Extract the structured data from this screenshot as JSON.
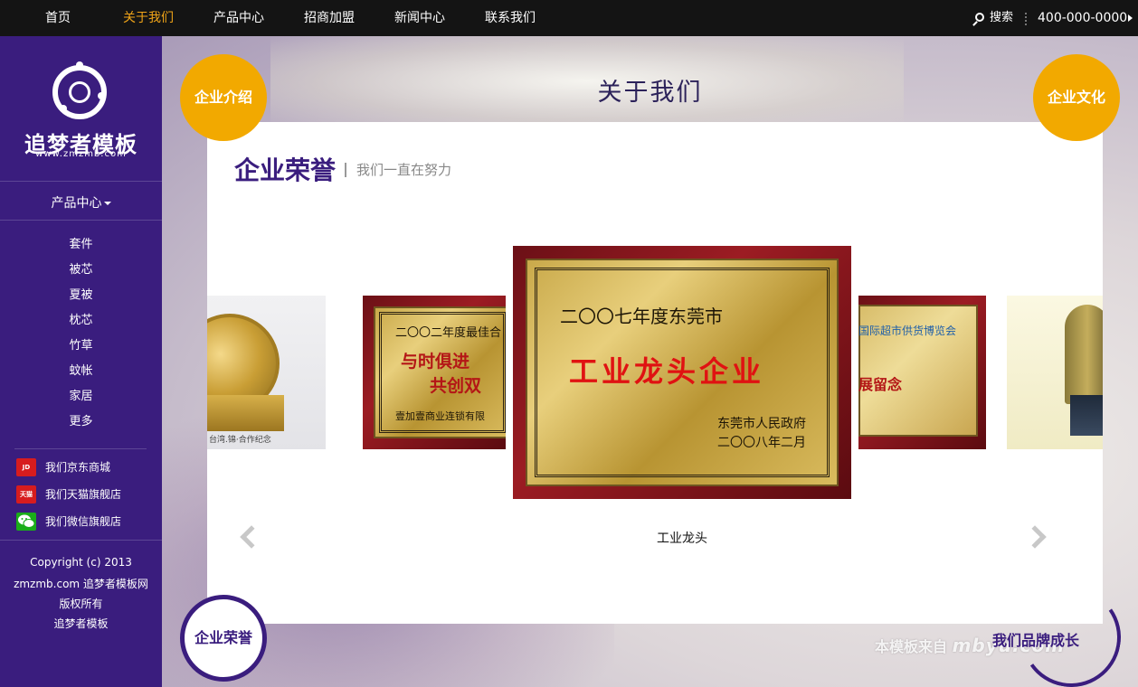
{
  "nav": {
    "items": [
      "首页",
      "关于我们",
      "产品中心",
      "招商加盟",
      "新闻中心",
      "联系我们"
    ],
    "active": "关于我们",
    "search_label": "搜索",
    "phone": "400-000-0000"
  },
  "sidebar": {
    "logo_text": "追梦者模板",
    "logo_sub": "www.zmzmb.com",
    "menu_title": "产品中心",
    "menu_items": [
      "套件",
      "被芯",
      "夏被",
      "枕芯",
      "竹草",
      "蚊帐",
      "家居",
      "更多"
    ],
    "shops": [
      {
        "label": "我们京东商城",
        "icon": "jd-icon",
        "color": "#d71c1e",
        "badge": "JD"
      },
      {
        "label": "我们天猫旗舰店",
        "icon": "tmall-icon",
        "color": "#d71c1e",
        "badge": "天猫"
      },
      {
        "label": "我们微信旗舰店",
        "icon": "wechat-icon",
        "color": "#1aad19",
        "badge": ""
      }
    ],
    "copyright_lines": [
      "Copyright (c) 2013",
      "zmzmb.com 追梦者模板网",
      "版权所有",
      "追梦者模板"
    ]
  },
  "main": {
    "page_title": "关于我们",
    "btn_intro": "企业介绍",
    "btn_culture": "企业文化",
    "btn_honor": "企业荣誉",
    "btn_brand": "我们品牌成长",
    "watermark_prefix": "本模板来自",
    "watermark_logo": "mbyu.com",
    "section_title": "企业荣誉",
    "section_subtitle": "我们一直在努力",
    "caption": "工业龙头",
    "plaque_center": {
      "line1": "二〇〇七年度东莞市",
      "line2": "工业龙头企业",
      "line3": "东莞市人民政府",
      "line4": "二〇〇八年二月"
    },
    "plaque_left": {
      "line1": "二〇〇二年度最佳合",
      "line2": "与时俱进",
      "line3": "共创双",
      "line4": "壹加壹商业连锁有限"
    },
    "plaque_right": {
      "line1": "国际超市供货博览会",
      "line2": "展留念"
    },
    "medal_caption": "台湾.锦·合作纪念",
    "colors": {
      "purple": "#3a1d7e",
      "gold": "#f2a900",
      "active_nav": "#f0a418"
    }
  }
}
